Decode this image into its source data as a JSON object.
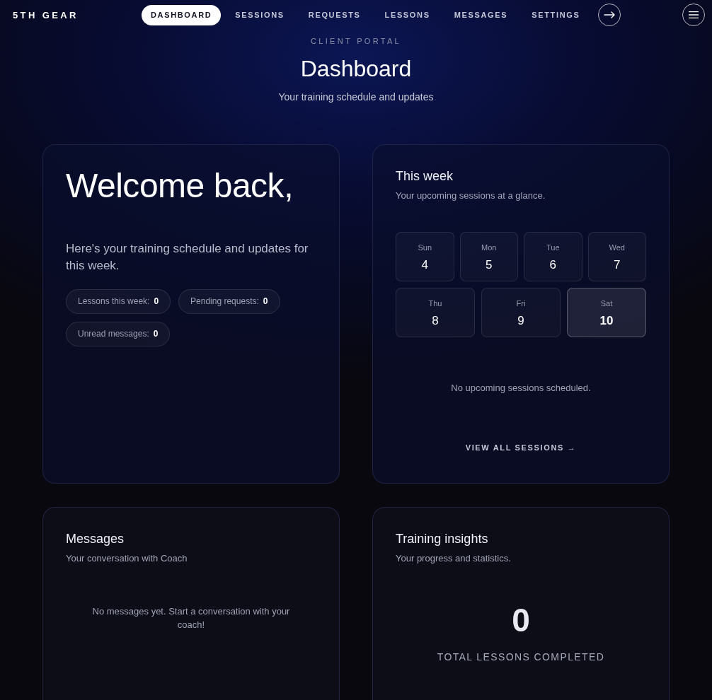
{
  "nav": {
    "logo": "5TH GEAR",
    "items": [
      {
        "label": "DASHBOARD",
        "selected": true
      },
      {
        "label": "SESSIONS",
        "selected": false
      },
      {
        "label": "REQUESTS",
        "selected": false
      },
      {
        "label": "LESSONS",
        "selected": false
      },
      {
        "label": "MESSAGES",
        "selected": false
      },
      {
        "label": "SETTINGS",
        "selected": false
      }
    ]
  },
  "header": {
    "eyebrow": "CLIENT PORTAL",
    "title": "Dashboard",
    "subtitle": "Your training schedule and updates"
  },
  "welcome_card": {
    "heading": "Welcome back,",
    "text": "Here's your training schedule and updates for this week.",
    "stats": [
      {
        "label": "Lessons this week:",
        "value": "0"
      },
      {
        "label": "Pending requests:",
        "value": "0"
      },
      {
        "label": "Unread messages:",
        "value": "0"
      }
    ]
  },
  "week_card": {
    "title": "This week",
    "subtitle": "Your upcoming sessions at a glance.",
    "days": [
      {
        "day": "Sun",
        "date": "4",
        "selected": false
      },
      {
        "day": "Mon",
        "date": "5",
        "selected": false
      },
      {
        "day": "Tue",
        "date": "6",
        "selected": false
      },
      {
        "day": "Wed",
        "date": "7",
        "selected": false
      },
      {
        "day": "Thu",
        "date": "8",
        "selected": false
      },
      {
        "day": "Fri",
        "date": "9",
        "selected": false
      },
      {
        "day": "Sat",
        "date": "10",
        "selected": true
      }
    ],
    "empty_text": "No upcoming sessions scheduled.",
    "link": "VIEW ALL SESSIONS →"
  },
  "messages_card": {
    "title": "Messages",
    "subtitle": "Your conversation with Coach",
    "empty_text": "No messages yet. Start a conversation with your coach!"
  },
  "insights_card": {
    "title": "Training insights",
    "subtitle": "Your progress and statistics.",
    "stats": [
      {
        "value": "0",
        "label": "TOTAL LESSONS COMPLETED"
      }
    ]
  }
}
